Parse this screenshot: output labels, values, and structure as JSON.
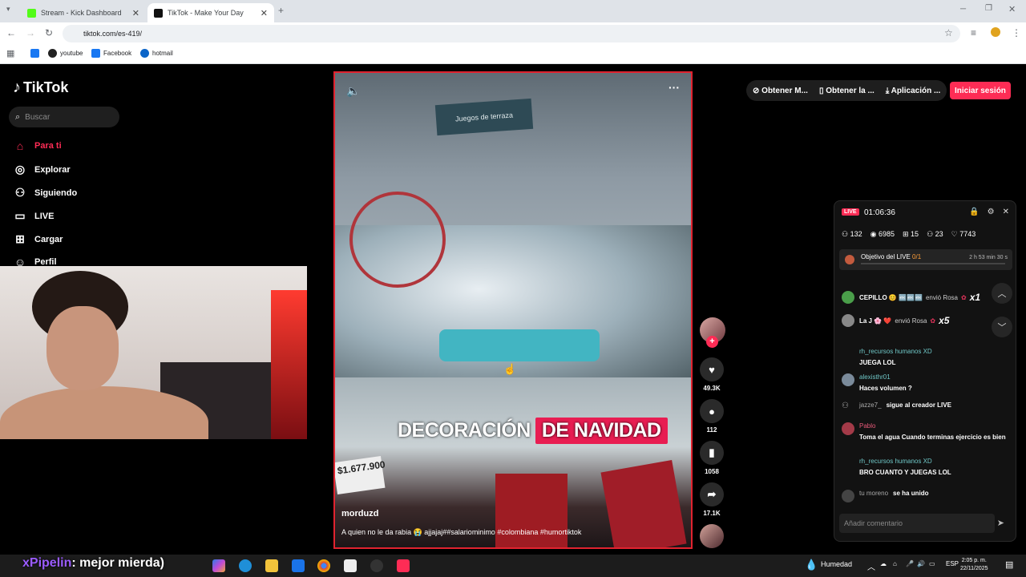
{
  "browser": {
    "tabs": [
      {
        "title": "Stream - Kick Dashboard",
        "fav_color": "#53fc18"
      },
      {
        "title": "TikTok - Make Your Day",
        "fav_color": "#111111"
      }
    ],
    "url": "tiktok.com/es-419/",
    "bookmarks": [
      "youtube",
      "Facebook",
      "hotmail"
    ]
  },
  "tiktok": {
    "logo": "TikTok",
    "search_placeholder": "Buscar",
    "nav": [
      {
        "label": "Para ti",
        "icon": "home-icon"
      },
      {
        "label": "Explorar",
        "icon": "compass-icon"
      },
      {
        "label": "Siguiendo",
        "icon": "following-icon"
      },
      {
        "label": "LIVE",
        "icon": "live-icon"
      },
      {
        "label": "Cargar",
        "icon": "upload-icon"
      },
      {
        "label": "Perfil",
        "icon": "profile-icon"
      }
    ],
    "top_links": [
      "Obtener M...",
      "Obtener la ...",
      "Aplicación ..."
    ],
    "login": "Iniciar sesión",
    "video": {
      "sign": "Juegos de terraza",
      "caption_a": "DECORACIÓN",
      "caption_b": "DE NAVIDAD",
      "price": "$1.677.900",
      "author": "morduzd",
      "description": "A quien no le da rabia 😭 ajjajaj##salariominimo #colombiana #humortiktok"
    },
    "actions": {
      "likes": "49.3K",
      "comments": "112",
      "saves": "1058",
      "shares": "17.1K"
    }
  },
  "live_panel": {
    "badge": "LIVE",
    "time": "01:06:36",
    "stats": [
      "132",
      "6985",
      "15",
      "23",
      "7743"
    ],
    "goal_label": "Objetivo del LIVE",
    "goal_progress": "0/1",
    "goal_time": "2 h 53 min 30 s",
    "gifts": [
      {
        "user": "CEPILLO 😊 🔤🔤🔤",
        "action": "envió Rosa",
        "mult": "x1"
      },
      {
        "user": "La J 🌸 ❤️",
        "action": "envió Rosa",
        "mult": "x5"
      }
    ],
    "comments": [
      {
        "user": "rh_recursos humanos XD",
        "text": "JUEGA LOL"
      },
      {
        "user": "alexisthr01",
        "text": "Haces volumen ?"
      },
      {
        "user": "jazze7_",
        "text": "sigue al creador LIVE"
      },
      {
        "user": "Pablo",
        "text": "Toma el agua Cuando terminas ejercicio es bien"
      },
      {
        "user": "rh_recursos humanos XD",
        "text": "BRO CUANTO Y JUEGAS LOL"
      },
      {
        "user": "tu moreno",
        "text": "se ha unido"
      }
    ],
    "add_comment_placeholder": "Añadir comentario"
  },
  "overlay": {
    "name": "xPipelin",
    "message": ": mejor mierda)"
  },
  "taskbar": {
    "weather": "Humedad",
    "lang": "ESP",
    "time": "2:05 p. m.",
    "date": "22/11/2025"
  }
}
